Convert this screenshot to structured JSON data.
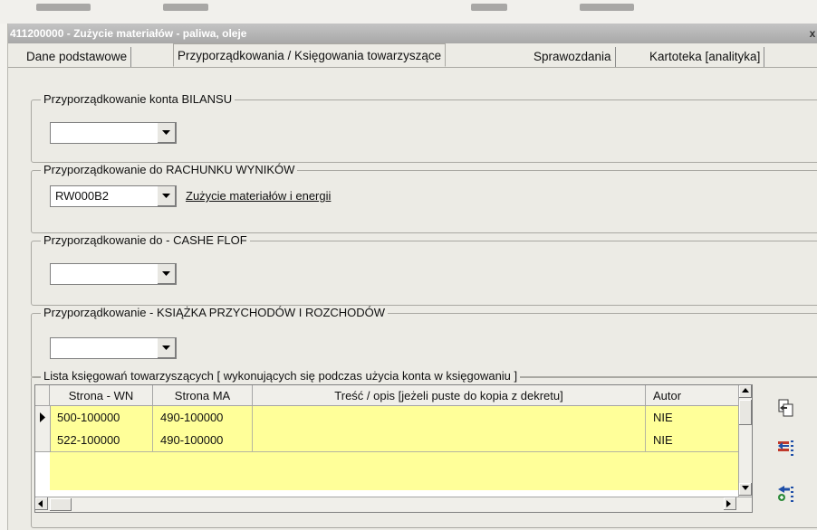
{
  "window": {
    "title": "411200000 - Zużycie materiałów - paliwa, oleje",
    "close_glyph": "x"
  },
  "tabs": [
    {
      "label": "Dane podstawowe"
    },
    {
      "label": "Przyporządkowania / Księgowania towarzyszące"
    },
    {
      "label": "Sprawozdania"
    },
    {
      "label": "Kartoteka [analityka]"
    }
  ],
  "groups": {
    "bilans": {
      "legend": "Przyporządkowanie konta  BILANSU",
      "combo_value": ""
    },
    "rachunek": {
      "legend": "Przyporządkowanie do RACHUNKU WYNIKÓW",
      "combo_value": "RW000B2",
      "link": "Zużycie materiałów i energii"
    },
    "cashflow": {
      "legend": "Przyporządkowanie do - CASHE FLOF",
      "combo_value": ""
    },
    "kpir": {
      "legend": "Przyporządkowanie  - KSIĄŻKA PRZYCHODÓW I ROZCHODÓW",
      "combo_value": ""
    },
    "lista": {
      "legend": "Lista księgowań towarzyszących [ wykonujących się podczas użycia konta w księgowaniu ]"
    }
  },
  "grid": {
    "columns": [
      "Strona - WN",
      "Strona MA",
      "Treść / opis [jeżeli puste do kopia z dekretu]",
      "Autor"
    ],
    "rows": [
      {
        "wn": "500-100000",
        "ma": "490-100000",
        "opis": "",
        "autor": "NIE"
      },
      {
        "wn": "522-100000",
        "ma": "490-100000",
        "opis": "",
        "autor": "NIE"
      }
    ]
  },
  "icons": [
    "copy-icon",
    "move-left-icon",
    "add-icon",
    "combo-arrow-icon",
    "row-pointer-icon"
  ],
  "colors": {
    "grid_row_bg": "#ffff99",
    "title_bg": "#b0b0b0"
  }
}
